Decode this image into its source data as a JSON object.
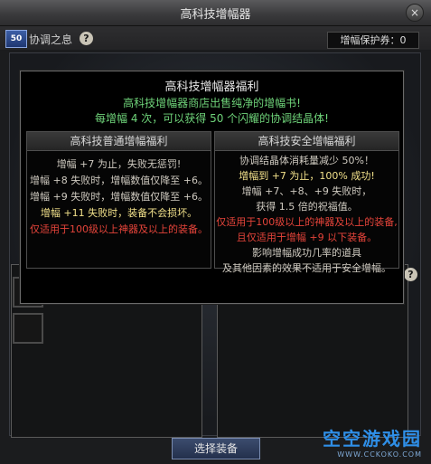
{
  "window": {
    "title": "高科技增幅器",
    "close_symbol": "×"
  },
  "toolbar": {
    "level_badge": "50",
    "hint_label": "协调之息",
    "help_symbol": "?",
    "protect_label": "增幅保护券：0"
  },
  "popup": {
    "title": "高科技增幅器福利",
    "line1": "高科技增幅器商店出售纯净的增幅书!",
    "line2": "每增幅 4 次，可以获得 50 个闪耀的协调结晶体!",
    "left": {
      "header": "高科技普通增幅福利",
      "lines": [
        "增幅 +7 为止，失败无惩罚!",
        "增幅 +8 失败时，增幅数值仅降至 +6。",
        "增幅 +9 失败时，增幅数值仅降至 +6。",
        "增幅 +11 失败时，装备不会损坏。",
        "仅适用于100级以上神器及以上的装备。"
      ]
    },
    "right": {
      "header": "高科技安全增幅福利",
      "lines": [
        "协调结晶体消耗量减少 50%！",
        "增幅到 +7 为止，100% 成功!",
        "增幅 +7、+8、+9 失败时，",
        "获得 1.5 倍的祝福值。",
        "仅适用于100级以上的神器及以上的装备,",
        "且仅适用于增幅 +9 以下装备。",
        "影响增幅成功几率的道具",
        "及其他因素的效果不适用于安全增幅。"
      ]
    }
  },
  "bottom": {
    "select_label": "选择装备",
    "help_symbol": "?"
  },
  "watermark": {
    "main": "空空游戏园",
    "sub": "WWW.CCKOKO.COM"
  }
}
